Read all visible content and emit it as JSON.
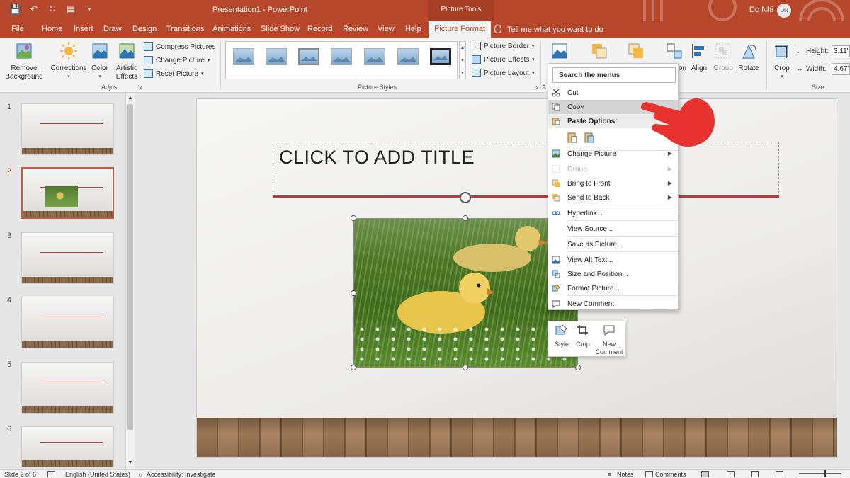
{
  "window": {
    "doc_title": "Presentation1 - PowerPoint",
    "contextual_group": "Picture Tools",
    "user_name": "Do Nhi",
    "user_initials": "DN"
  },
  "tabs": [
    {
      "label": "File"
    },
    {
      "label": "Home"
    },
    {
      "label": "Insert"
    },
    {
      "label": "Draw"
    },
    {
      "label": "Design"
    },
    {
      "label": "Transitions"
    },
    {
      "label": "Animations"
    },
    {
      "label": "Slide Show"
    },
    {
      "label": "Record"
    },
    {
      "label": "Review"
    },
    {
      "label": "View"
    },
    {
      "label": "Help"
    },
    {
      "label": "Picture Format",
      "active": true
    }
  ],
  "tell_me": "Tell me what you want to do",
  "ribbon": {
    "remove_background_1": "Remove",
    "remove_background_2": "Background",
    "corrections": "Corrections",
    "color": "Color",
    "artistic_effects_1": "Artistic",
    "artistic_effects_2": "Effects",
    "compress_pictures": "Compress Pictures",
    "change_picture": "Change Picture",
    "reset_picture": "Reset Picture",
    "adjust_label": "Adjust",
    "picture_styles_label": "Picture Styles",
    "picture_border": "Picture Border",
    "picture_effects": "Picture Effects",
    "picture_layout": "Picture Layout",
    "accessibility_partial": "A",
    "bring_forward_partial": "on",
    "align": "Align",
    "group": "Group",
    "rotate": "Rotate",
    "crop": "Crop",
    "height_label": "Height:",
    "height_value": "3.11\"",
    "width_label": "Width:",
    "width_value": "4.67\"",
    "size_label": "Size"
  },
  "slides": [
    {
      "num": "1"
    },
    {
      "num": "2",
      "active": true
    },
    {
      "num": "3"
    },
    {
      "num": "4"
    },
    {
      "num": "5"
    },
    {
      "num": "6"
    }
  ],
  "slide": {
    "title_placeholder": "CLICK TO ADD TITLE"
  },
  "context_menu": {
    "search": "Search the menus",
    "items": [
      {
        "label": "Cut",
        "icon": "scissors-icon"
      },
      {
        "label": "Copy",
        "icon": "copy-icon",
        "hover": true
      },
      {
        "label": "Paste Options:",
        "icon": "paste-icon",
        "header": true
      },
      {
        "label": "Change Picture",
        "icon": "change-picture-icon",
        "submenu": true
      },
      {
        "label": "Group",
        "icon": "group-icon",
        "submenu": true,
        "disabled": true
      },
      {
        "label": "Bring to Front",
        "icon": "bring-front-icon",
        "submenu": true
      },
      {
        "label": "Send to Back",
        "icon": "send-back-icon",
        "submenu": true
      },
      {
        "label": "Hyperlink...",
        "icon": "hyperlink-icon"
      },
      {
        "label": "View Source...",
        "icon": ""
      },
      {
        "label": "Save as Picture...",
        "icon": ""
      },
      {
        "label": "View Alt Text...",
        "icon": "alt-text-icon"
      },
      {
        "label": "Size and Position...",
        "icon": "size-position-icon"
      },
      {
        "label": "Format Picture...",
        "icon": "format-picture-icon"
      },
      {
        "label": "New Comment",
        "icon": "comment-icon"
      }
    ]
  },
  "mini_toolbar": {
    "style": "Style",
    "crop": "Crop",
    "new_comment_1": "New",
    "new_comment_2": "Comment"
  },
  "status": {
    "slide_of": "Slide 2 of 6",
    "language": "English (United States)",
    "accessibility": "Accessibility: Investigate",
    "notes": "Notes",
    "comments": "Comments"
  },
  "colors": {
    "accent": "#b7472a",
    "title_line": "#c0383e",
    "hand": "#e8322f"
  }
}
